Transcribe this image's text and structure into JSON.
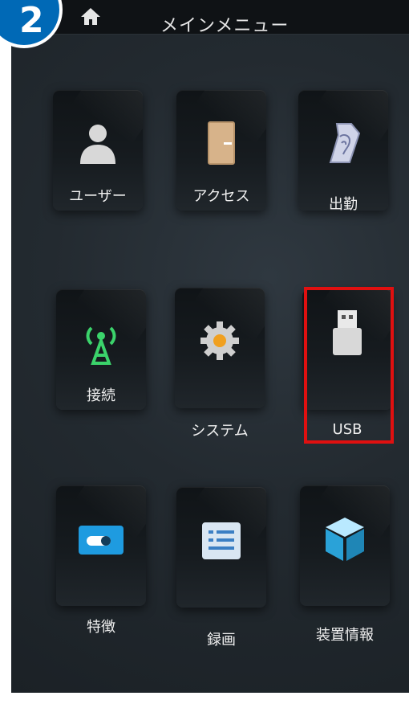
{
  "step_badge": "2",
  "header": {
    "title": "メインメニュー"
  },
  "menu": {
    "items": [
      {
        "label": "ユーザー",
        "icon": "user-icon"
      },
      {
        "label": "アクセス",
        "icon": "door-icon"
      },
      {
        "label": "出勤",
        "icon": "fingerprint-scroll-icon"
      },
      {
        "label": "接続",
        "icon": "antenna-icon"
      },
      {
        "label": "システム",
        "icon": "gear-icon"
      },
      {
        "label": "USB",
        "icon": "usb-icon"
      },
      {
        "label": "特徴",
        "icon": "toggle-icon"
      },
      {
        "label": "録画",
        "icon": "document-list-icon"
      },
      {
        "label": "装置情報",
        "icon": "cube-icon"
      }
    ]
  },
  "colors": {
    "badge_blue": "#0069b6",
    "highlight_red": "#e01010"
  }
}
